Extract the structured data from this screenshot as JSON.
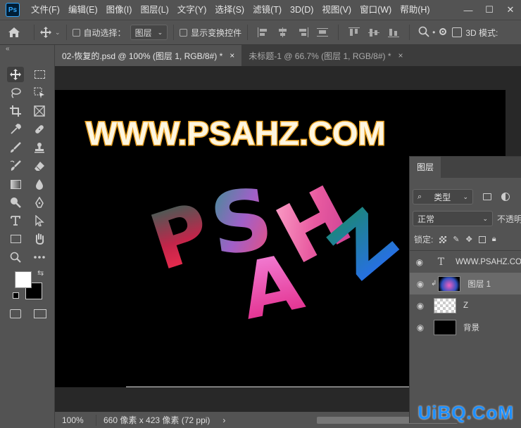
{
  "app": {
    "logo": "Ps"
  },
  "menu": [
    "文件(F)",
    "编辑(E)",
    "图像(I)",
    "图层(L)",
    "文字(Y)",
    "选择(S)",
    "滤镜(T)",
    "3D(D)",
    "视图(V)",
    "窗口(W)",
    "帮助(H)"
  ],
  "window_controls": {
    "minimize": "—",
    "maximize": "☐",
    "close": "✕"
  },
  "options": {
    "auto_select_label": "自动选择：",
    "auto_select_value": "图层",
    "transform_label": "显示变换控件",
    "mode_3d": "3D 模式:"
  },
  "tabs": [
    {
      "label": "02-恢复的.psd @ 100% (图层 1, RGB/8#) *",
      "close": "×"
    },
    {
      "label": "未标题-1 @ 66.7% (图层 1, RGB/8#) *",
      "close": "×"
    }
  ],
  "canvas": {
    "headline": "WWW.PSAHZ.COM",
    "letters": [
      "P",
      "S",
      "A",
      "H",
      "Z"
    ]
  },
  "status": {
    "zoom": "100%",
    "doc_info": "660 像素 x 423 像素 (72 ppi)",
    "arrow": "›"
  },
  "layers_panel": {
    "tab": "图层",
    "filter_label": "类型",
    "blend_mode": "正常",
    "opacity_label": "不透明",
    "lock_label": "锁定:",
    "layers": [
      {
        "name": "WWW.PSAHZ.CO",
        "kind": "text"
      },
      {
        "name": "图层 1",
        "kind": "image"
      },
      {
        "name": "Z",
        "kind": "transparent"
      },
      {
        "name": "背景",
        "kind": "fill"
      }
    ]
  },
  "watermark": "UiBQ.CoM",
  "colors": {
    "ui_bg": "#535353",
    "canvas": "#000000",
    "headline_fill": "#fdf6e0",
    "headline_stroke": "#e8a020",
    "watermark": "#1e90ff"
  }
}
